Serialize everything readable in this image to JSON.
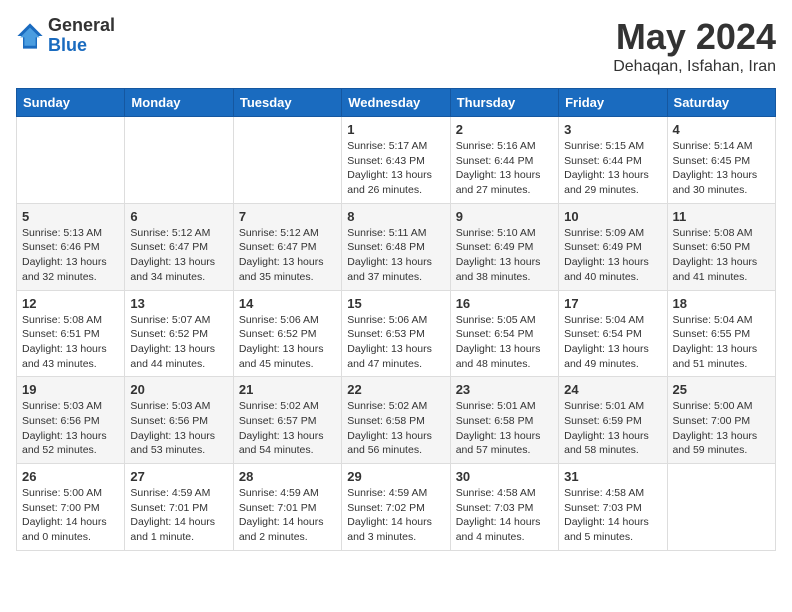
{
  "header": {
    "logo_general": "General",
    "logo_blue": "Blue",
    "month_year": "May 2024",
    "location": "Dehaqan, Isfahan, Iran"
  },
  "weekdays": [
    "Sunday",
    "Monday",
    "Tuesday",
    "Wednesday",
    "Thursday",
    "Friday",
    "Saturday"
  ],
  "weeks": [
    [
      {
        "day": "",
        "info": ""
      },
      {
        "day": "",
        "info": ""
      },
      {
        "day": "",
        "info": ""
      },
      {
        "day": "1",
        "info": "Sunrise: 5:17 AM\nSunset: 6:43 PM\nDaylight: 13 hours\nand 26 minutes."
      },
      {
        "day": "2",
        "info": "Sunrise: 5:16 AM\nSunset: 6:44 PM\nDaylight: 13 hours\nand 27 minutes."
      },
      {
        "day": "3",
        "info": "Sunrise: 5:15 AM\nSunset: 6:44 PM\nDaylight: 13 hours\nand 29 minutes."
      },
      {
        "day": "4",
        "info": "Sunrise: 5:14 AM\nSunset: 6:45 PM\nDaylight: 13 hours\nand 30 minutes."
      }
    ],
    [
      {
        "day": "5",
        "info": "Sunrise: 5:13 AM\nSunset: 6:46 PM\nDaylight: 13 hours\nand 32 minutes."
      },
      {
        "day": "6",
        "info": "Sunrise: 5:12 AM\nSunset: 6:47 PM\nDaylight: 13 hours\nand 34 minutes."
      },
      {
        "day": "7",
        "info": "Sunrise: 5:12 AM\nSunset: 6:47 PM\nDaylight: 13 hours\nand 35 minutes."
      },
      {
        "day": "8",
        "info": "Sunrise: 5:11 AM\nSunset: 6:48 PM\nDaylight: 13 hours\nand 37 minutes."
      },
      {
        "day": "9",
        "info": "Sunrise: 5:10 AM\nSunset: 6:49 PM\nDaylight: 13 hours\nand 38 minutes."
      },
      {
        "day": "10",
        "info": "Sunrise: 5:09 AM\nSunset: 6:49 PM\nDaylight: 13 hours\nand 40 minutes."
      },
      {
        "day": "11",
        "info": "Sunrise: 5:08 AM\nSunset: 6:50 PM\nDaylight: 13 hours\nand 41 minutes."
      }
    ],
    [
      {
        "day": "12",
        "info": "Sunrise: 5:08 AM\nSunset: 6:51 PM\nDaylight: 13 hours\nand 43 minutes."
      },
      {
        "day": "13",
        "info": "Sunrise: 5:07 AM\nSunset: 6:52 PM\nDaylight: 13 hours\nand 44 minutes."
      },
      {
        "day": "14",
        "info": "Sunrise: 5:06 AM\nSunset: 6:52 PM\nDaylight: 13 hours\nand 45 minutes."
      },
      {
        "day": "15",
        "info": "Sunrise: 5:06 AM\nSunset: 6:53 PM\nDaylight: 13 hours\nand 47 minutes."
      },
      {
        "day": "16",
        "info": "Sunrise: 5:05 AM\nSunset: 6:54 PM\nDaylight: 13 hours\nand 48 minutes."
      },
      {
        "day": "17",
        "info": "Sunrise: 5:04 AM\nSunset: 6:54 PM\nDaylight: 13 hours\nand 49 minutes."
      },
      {
        "day": "18",
        "info": "Sunrise: 5:04 AM\nSunset: 6:55 PM\nDaylight: 13 hours\nand 51 minutes."
      }
    ],
    [
      {
        "day": "19",
        "info": "Sunrise: 5:03 AM\nSunset: 6:56 PM\nDaylight: 13 hours\nand 52 minutes."
      },
      {
        "day": "20",
        "info": "Sunrise: 5:03 AM\nSunset: 6:56 PM\nDaylight: 13 hours\nand 53 minutes."
      },
      {
        "day": "21",
        "info": "Sunrise: 5:02 AM\nSunset: 6:57 PM\nDaylight: 13 hours\nand 54 minutes."
      },
      {
        "day": "22",
        "info": "Sunrise: 5:02 AM\nSunset: 6:58 PM\nDaylight: 13 hours\nand 56 minutes."
      },
      {
        "day": "23",
        "info": "Sunrise: 5:01 AM\nSunset: 6:58 PM\nDaylight: 13 hours\nand 57 minutes."
      },
      {
        "day": "24",
        "info": "Sunrise: 5:01 AM\nSunset: 6:59 PM\nDaylight: 13 hours\nand 58 minutes."
      },
      {
        "day": "25",
        "info": "Sunrise: 5:00 AM\nSunset: 7:00 PM\nDaylight: 13 hours\nand 59 minutes."
      }
    ],
    [
      {
        "day": "26",
        "info": "Sunrise: 5:00 AM\nSunset: 7:00 PM\nDaylight: 14 hours\nand 0 minutes."
      },
      {
        "day": "27",
        "info": "Sunrise: 4:59 AM\nSunset: 7:01 PM\nDaylight: 14 hours\nand 1 minute."
      },
      {
        "day": "28",
        "info": "Sunrise: 4:59 AM\nSunset: 7:01 PM\nDaylight: 14 hours\nand 2 minutes."
      },
      {
        "day": "29",
        "info": "Sunrise: 4:59 AM\nSunset: 7:02 PM\nDaylight: 14 hours\nand 3 minutes."
      },
      {
        "day": "30",
        "info": "Sunrise: 4:58 AM\nSunset: 7:03 PM\nDaylight: 14 hours\nand 4 minutes."
      },
      {
        "day": "31",
        "info": "Sunrise: 4:58 AM\nSunset: 7:03 PM\nDaylight: 14 hours\nand 5 minutes."
      },
      {
        "day": "",
        "info": ""
      }
    ]
  ]
}
